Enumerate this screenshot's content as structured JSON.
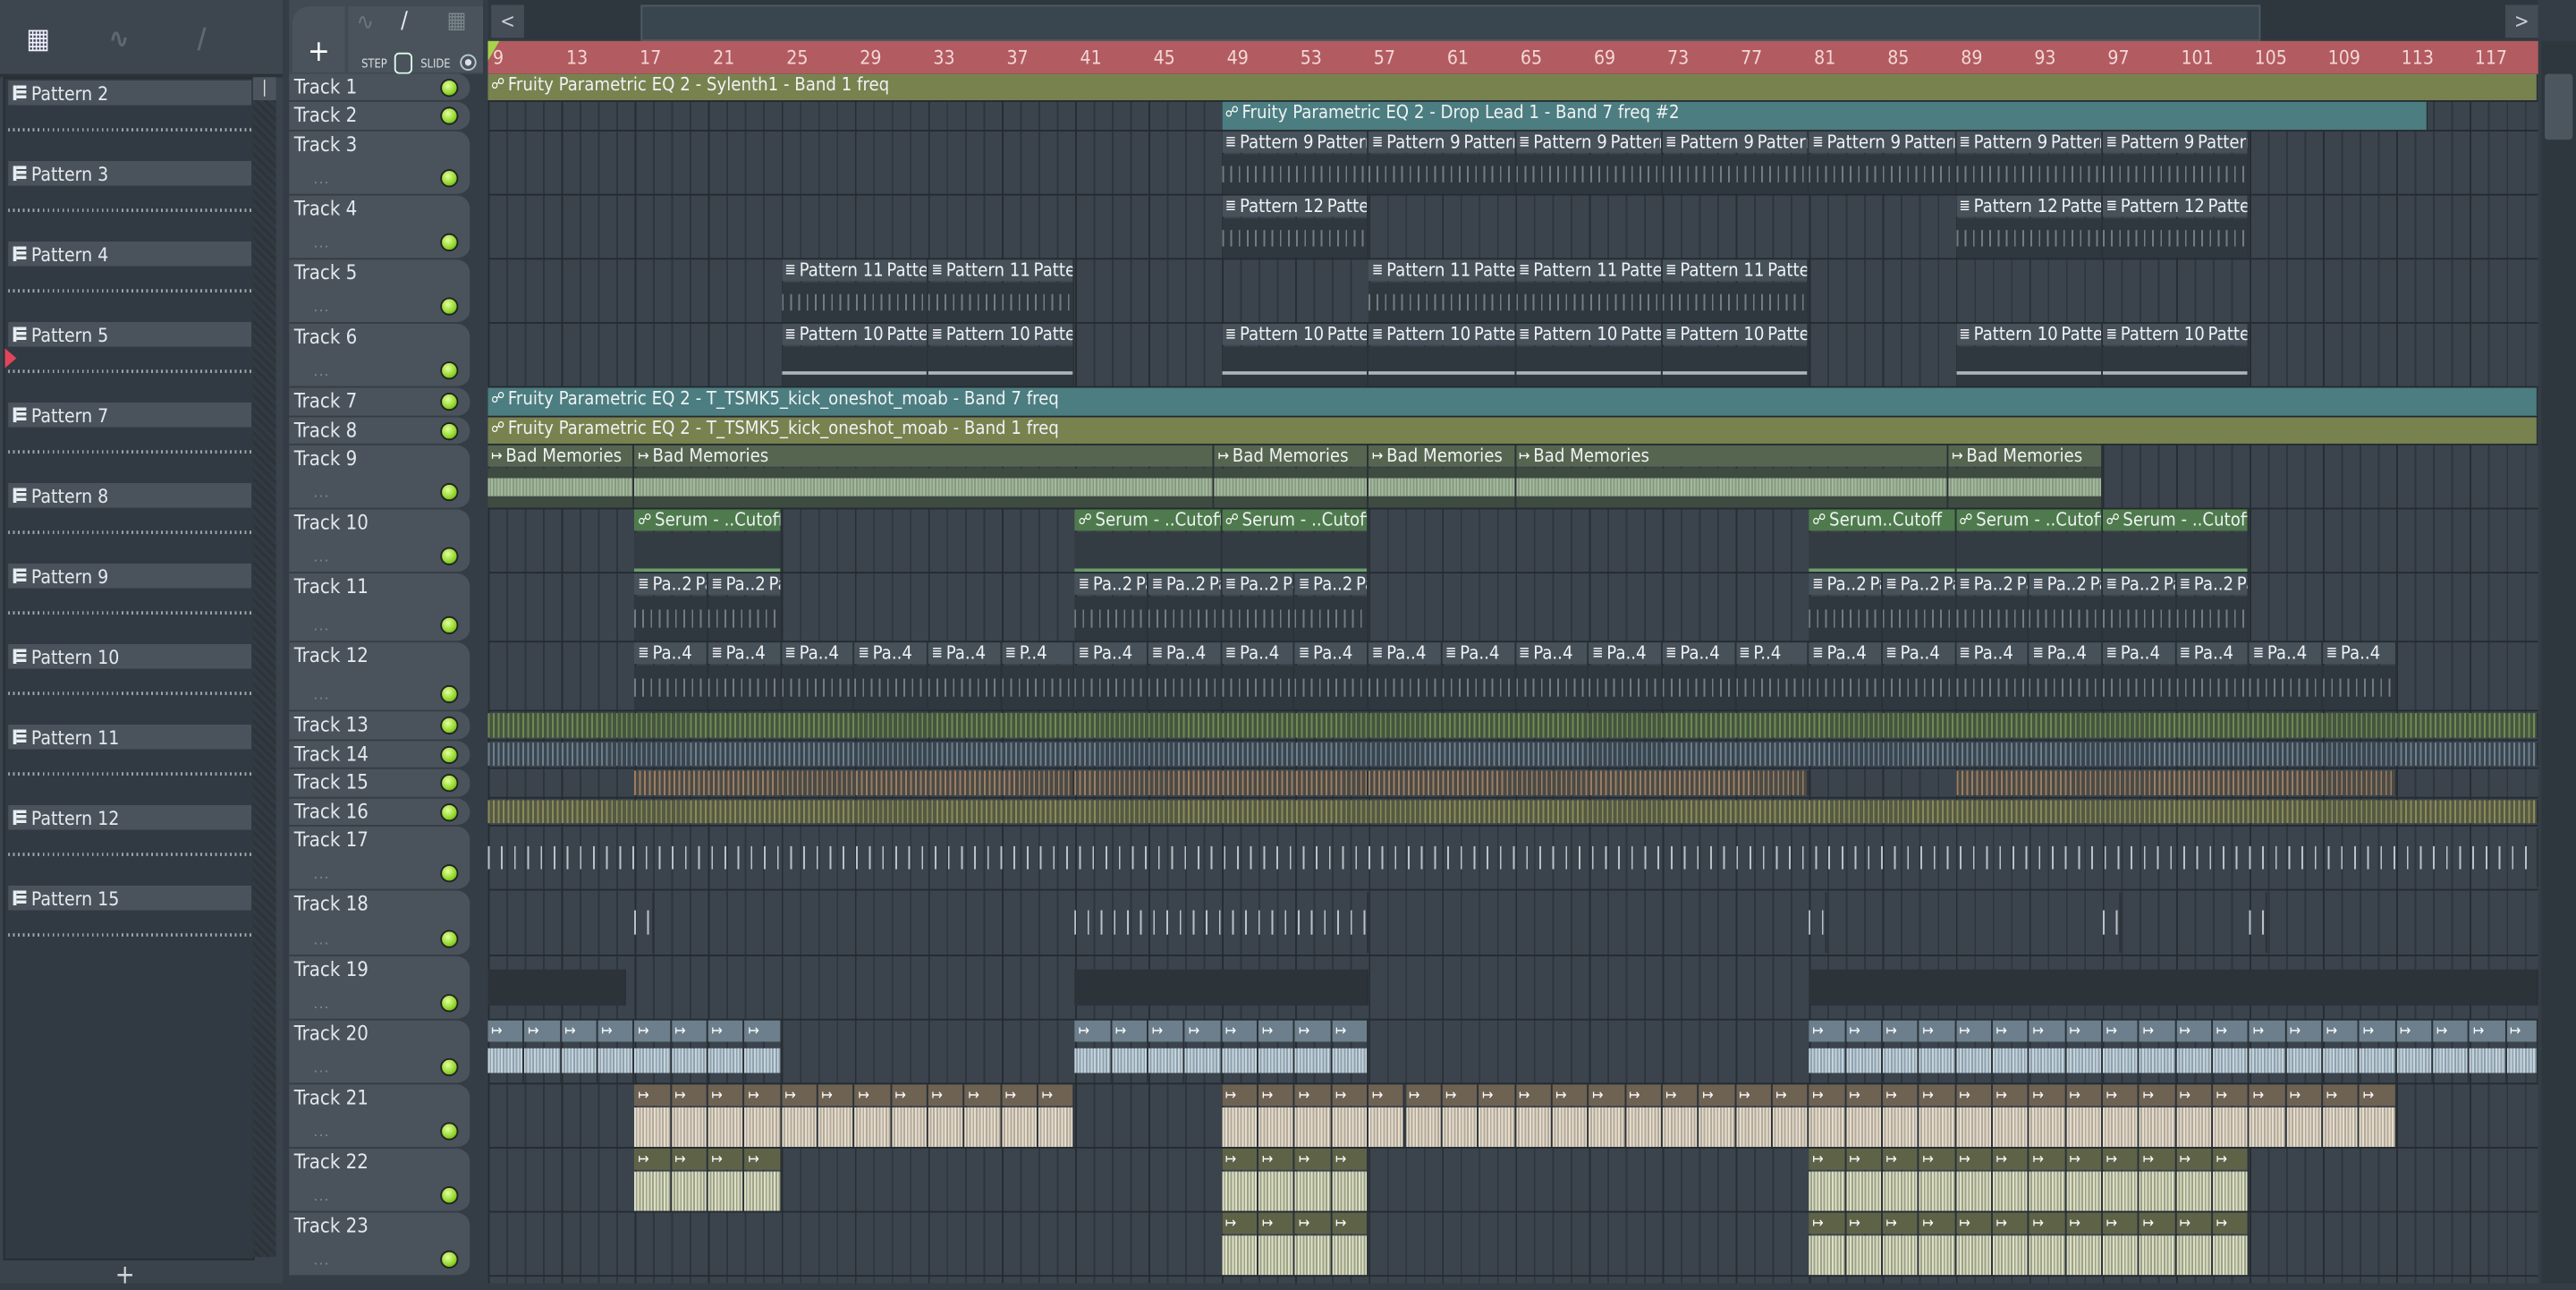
{
  "header": {
    "add_label": "+",
    "step_label": "STEP",
    "slide_label": "SLIDE",
    "scroll_left": "<",
    "scroll_right": ">"
  },
  "pattern_picker": {
    "items": [
      {
        "label": "Pattern 2"
      },
      {
        "label": "Pattern 3"
      },
      {
        "label": "Pattern 4"
      },
      {
        "label": "Pattern 5",
        "selected": true
      },
      {
        "label": "Pattern 7"
      },
      {
        "label": "Pattern 8"
      },
      {
        "label": "Pattern 9"
      },
      {
        "label": "Pattern 10"
      },
      {
        "label": "Pattern 11"
      },
      {
        "label": "Pattern 12"
      },
      {
        "label": "Pattern 15"
      }
    ],
    "add_label": "+"
  },
  "ruler": {
    "bars": [
      "9",
      "13",
      "17",
      "21",
      "25",
      "29",
      "33",
      "37",
      "41",
      "45",
      "49",
      "53",
      "57",
      "61",
      "65",
      "69",
      "73",
      "77",
      "81",
      "85",
      "89",
      "93",
      "97",
      "101",
      "105",
      "109",
      "113",
      "117"
    ]
  },
  "colors": {
    "ruler": "#b25b60",
    "led": "#8fd62a",
    "automation_olive": "#77824f",
    "automation_teal": "#4c7d80",
    "serum": "#4f7a4d"
  },
  "tracks": [
    {
      "name": "Track 1",
      "clips": [
        {
          "k": "auto-olive",
          "s": 9,
          "e": 120.7,
          "l": "Fruity Parametric EQ 2 - Sylenth1 - Band 1 freq"
        }
      ]
    },
    {
      "name": "Track 2",
      "clips": [
        {
          "k": "auto-teal",
          "s": 49,
          "e": 114.7,
          "l": "Fruity Parametric EQ 2 - Drop Lead 1 - Band 7 freq #2"
        }
      ]
    },
    {
      "name": "Track 3",
      "pattern": "Pattern 9",
      "starts": [
        49,
        57,
        65,
        73,
        81,
        89,
        97
      ],
      "len": 8
    },
    {
      "name": "Track 4",
      "pattern": "Pattern 12",
      "starts": [
        49,
        89,
        97
      ],
      "len": 8
    },
    {
      "name": "Track 5",
      "pattern": "Pattern 11",
      "starts": [
        25,
        33,
        57,
        65,
        73
      ],
      "len": 8
    },
    {
      "name": "Track 6",
      "pattern": "Pattern 10",
      "starts": [
        25,
        33,
        49,
        57,
        65,
        73,
        89,
        97
      ],
      "len": 8
    },
    {
      "name": "Track 7",
      "clips": [
        {
          "k": "auto-teal",
          "s": 9,
          "e": 120.7,
          "l": "Fruity Parametric EQ 2 - T_TSMK5_kick_oneshot_moab - Band 7 freq"
        }
      ]
    },
    {
      "name": "Track 8",
      "clips": [
        {
          "k": "auto-olive",
          "s": 9,
          "e": 120.7,
          "l": "Fruity Parametric EQ 2 - T_TSMK5_kick_oneshot_moab - Band 1 freq"
        }
      ]
    },
    {
      "name": "Track 9",
      "clips": [
        {
          "k": "audio",
          "s": 9,
          "e": 17,
          "l": "Bad Memories"
        },
        {
          "k": "audio",
          "s": 17,
          "e": 48.6,
          "l": "Bad Memories"
        },
        {
          "k": "audio",
          "s": 48.6,
          "e": 57,
          "l": "Bad Memories"
        },
        {
          "k": "audio",
          "s": 57,
          "e": 65,
          "l": "Bad Memories"
        },
        {
          "k": "audio",
          "s": 65,
          "e": 88.6,
          "l": "Bad Memories"
        },
        {
          "k": "audio",
          "s": 88.6,
          "e": 97,
          "l": "Bad Memories"
        }
      ]
    },
    {
      "name": "Track 10",
      "clips": [
        {
          "k": "serum",
          "s": 17,
          "e": 25,
          "l": "Serum - ..Cutoff"
        },
        {
          "k": "serum",
          "s": 41,
          "e": 49,
          "l": "Serum - ..Cutoff"
        },
        {
          "k": "serum",
          "s": 49,
          "e": 57,
          "l": "Serum - ..Cutoff"
        },
        {
          "k": "serum",
          "s": 81,
          "e": 89,
          "l": "Serum..Cutoff"
        },
        {
          "k": "serum",
          "s": 89,
          "e": 97,
          "l": "Serum - ..Cutoff"
        },
        {
          "k": "serum",
          "s": 97,
          "e": 105,
          "l": "Serum - ..Cutoff"
        }
      ]
    },
    {
      "name": "Track 11",
      "pattern": "Pa..2",
      "starts": [
        17,
        21,
        41,
        45,
        49,
        53,
        81,
        85,
        89,
        93,
        97,
        101
      ],
      "len": 4
    },
    {
      "name": "Track 12",
      "clips": [
        {
          "k": "pat",
          "s": 17,
          "e": 21,
          "l": "Pa..4"
        },
        {
          "k": "pat",
          "s": 21,
          "e": 25,
          "l": "Pa..4"
        },
        {
          "k": "pat",
          "s": 25,
          "e": 29,
          "l": "Pa..4"
        },
        {
          "k": "pat",
          "s": 29,
          "e": 33,
          "l": "Pa..4"
        },
        {
          "k": "pat",
          "s": 33,
          "e": 37,
          "l": "Pa..4"
        },
        {
          "k": "pat",
          "s": 37,
          "e": 41,
          "l": "P..4"
        },
        {
          "k": "pat",
          "s": 41,
          "e": 45,
          "l": "Pa..4"
        },
        {
          "k": "pat",
          "s": 45,
          "e": 49,
          "l": "Pa..4"
        },
        {
          "k": "pat",
          "s": 49,
          "e": 53,
          "l": "Pa..4"
        },
        {
          "k": "pat",
          "s": 53,
          "e": 57,
          "l": "Pa..4"
        },
        {
          "k": "pat",
          "s": 57,
          "e": 61,
          "l": "Pa..4"
        },
        {
          "k": "pat",
          "s": 61,
          "e": 65,
          "l": "Pa..4"
        },
        {
          "k": "pat",
          "s": 65,
          "e": 69,
          "l": "Pa..4"
        },
        {
          "k": "pat",
          "s": 69,
          "e": 73,
          "l": "Pa..4"
        },
        {
          "k": "pat",
          "s": 73,
          "e": 77,
          "l": "Pa..4"
        },
        {
          "k": "pat",
          "s": 77,
          "e": 81,
          "l": "P..4"
        },
        {
          "k": "pat",
          "s": 81,
          "e": 85,
          "l": "Pa..4"
        },
        {
          "k": "pat",
          "s": 85,
          "e": 89,
          "l": "Pa..4"
        },
        {
          "k": "pat",
          "s": 89,
          "e": 93,
          "l": "Pa..4"
        },
        {
          "k": "pat",
          "s": 93,
          "e": 97,
          "l": "Pa..4"
        },
        {
          "k": "pat",
          "s": 97,
          "e": 101,
          "l": "Pa..4"
        },
        {
          "k": "pat",
          "s": 101,
          "e": 105,
          "l": "Pa..4"
        },
        {
          "k": "pat",
          "s": 105,
          "e": 109,
          "l": "Pa..4"
        },
        {
          "k": "pat",
          "s": 109,
          "e": 113,
          "l": "Pa..4"
        }
      ]
    },
    {
      "name": "Track 13",
      "bands": [
        {
          "c": "green",
          "s": 9,
          "e": 120.7
        }
      ]
    },
    {
      "name": "Track 14",
      "bands": [
        {
          "c": "slate",
          "s": 9,
          "e": 120.7
        }
      ]
    },
    {
      "name": "Track 15",
      "bands": [
        {
          "c": "brown",
          "s": 17,
          "e": 41
        },
        {
          "c": "brown",
          "s": 41,
          "e": 57
        },
        {
          "c": "brown",
          "s": 57,
          "e": 81
        },
        {
          "c": "brown",
          "s": 89,
          "e": 113
        }
      ]
    },
    {
      "name": "Track 16",
      "bands": [
        {
          "c": "olive",
          "s": 9,
          "e": 120.7
        }
      ]
    },
    {
      "name": "Track 17",
      "bands": [
        {
          "c": "hits",
          "s": 9,
          "e": 120.7
        }
      ]
    },
    {
      "name": "Track 18",
      "bands": [
        {
          "c": "hits",
          "s": 17,
          "e": 18
        },
        {
          "c": "hits",
          "s": 41,
          "e": 57
        },
        {
          "c": "hits",
          "s": 81,
          "e": 82
        },
        {
          "c": "hits",
          "s": 97,
          "e": 98
        },
        {
          "c": "hits",
          "s": 105,
          "e": 106
        }
      ]
    },
    {
      "name": "Track 19",
      "bands": [
        {
          "c": "dark",
          "s": 9,
          "e": 16.5
        },
        {
          "c": "dark",
          "s": 41,
          "e": 57
        },
        {
          "c": "dark",
          "s": 81,
          "e": 120.7
        }
      ]
    },
    {
      "name": "Track 20",
      "slices": {
        "c": "blue",
        "ranges": [
          [
            9,
            17
          ],
          [
            17,
            25
          ],
          [
            41,
            49
          ],
          [
            49,
            57
          ],
          [
            81,
            89
          ],
          [
            89,
            120.7
          ]
        ]
      }
    },
    {
      "name": "Track 21",
      "slices": {
        "c": "brown",
        "ranges": [
          [
            17,
            41
          ],
          [
            49,
            113
          ]
        ]
      }
    },
    {
      "name": "Track 22",
      "slices": {
        "c": "olive",
        "ranges": [
          [
            17,
            25
          ],
          [
            49,
            57
          ],
          [
            81,
            105
          ]
        ]
      }
    },
    {
      "name": "Track 23",
      "slices": {
        "c": "olive",
        "ranges": [
          [
            49,
            57
          ],
          [
            81,
            105
          ]
        ]
      }
    }
  ]
}
